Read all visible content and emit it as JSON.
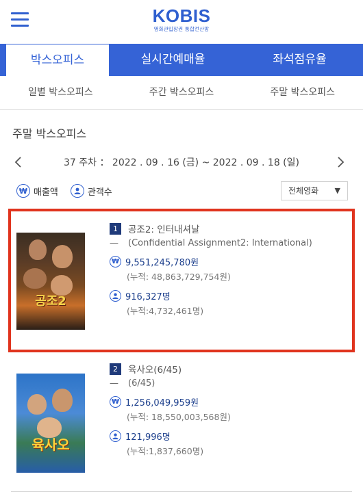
{
  "header": {
    "logo": "KOBIS",
    "logo_sub": "영화관입장권 통합전산망"
  },
  "tabs": [
    {
      "label": "박스오피스",
      "active": true
    },
    {
      "label": "실시간예매율",
      "active": false
    },
    {
      "label": "좌석점유율",
      "active": false
    }
  ],
  "subtabs": [
    "일별 박스오피스",
    "주간 박스오피스",
    "주말 박스오피스"
  ],
  "section_title": "주말 박스오피스",
  "period": "37 주차 ： 2022 . 09 . 16 (금) ~ 2022 . 09 . 18 (일)",
  "legend": {
    "sales_label": "매출액",
    "audience_label": "관객수"
  },
  "filter": {
    "selected": "전체영화"
  },
  "movies": [
    {
      "rank": "1",
      "title": "공조2: 인터내셔날",
      "original_title": "(Confidential Assignment2: International)",
      "sales": "9,551,245,780원",
      "sales_total": "(누적: 48,863,729,754원)",
      "audience": "916,327명",
      "audience_total": "(누적:4,732,461명)",
      "poster_text": "공조2"
    },
    {
      "rank": "2",
      "title": "육사오(6/45)",
      "original_title": "(6/45)",
      "sales": "1,256,049,959원",
      "sales_total": "(누적: 18,550,003,568원)",
      "audience": "121,996명",
      "audience_total": "(누적:1,837,660명)",
      "poster_text": "육사오"
    }
  ],
  "colors": {
    "brand": "#2f5fcf",
    "tab_bg": "#3563d6",
    "highlight": "#e0341e",
    "rank_bg": "#1f3a7a"
  },
  "icons": {
    "menu": "hamburger-icon",
    "prev": "chevron-left-icon",
    "next": "chevron-right-icon",
    "won": "won-icon",
    "person": "person-icon"
  }
}
